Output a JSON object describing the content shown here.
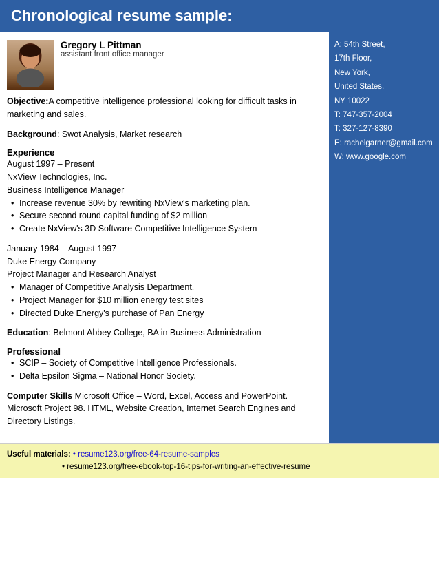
{
  "header": {
    "title": "Chronological resume sample:"
  },
  "profile": {
    "name": "Gregory L Pittman",
    "job_title": "assistant front office manager",
    "photo_alt": "profile photo"
  },
  "sidebar": {
    "address_line1": "A: 54th Street,",
    "address_line2": "17th Floor,",
    "address_line3": "New York,",
    "address_line4": "United States.",
    "address_line5": "NY 10022",
    "phone1_label": "T:",
    "phone1": "747-357-2004",
    "phone2_label": "T:",
    "phone2": "327-127-8390",
    "email_label": "E:",
    "email": "rachelgarner@gmail.com",
    "web_label": "W:",
    "web": "www.google.com"
  },
  "objective": {
    "label": "Objective:",
    "text": "A competitive intelligence professional looking for difficult tasks in marketing and sales."
  },
  "background": {
    "label": "Background",
    "text": ": Swot Analysis, Market research"
  },
  "experience": {
    "label": "Experience",
    "job1_dates": "August 1997 – Present",
    "job1_company": "NxView Technologies, Inc.",
    "job1_title": "Business Intelligence Manager",
    "job1_bullets": [
      "Increase revenue 30% by rewriting NxView's marketing plan.",
      "Secure second round capital funding of $2 million",
      "Create NxView's 3D Software Competitive Intelligence System"
    ],
    "job2_dates": "January 1984 – August 1997",
    "job2_company": "Duke Energy Company",
    "job2_title": "Project Manager and Research Analyst",
    "job2_bullets": [
      "Manager of Competitive Analysis Department.",
      "Project Manager for $10 million energy test sites",
      "Directed Duke Energy's purchase of Pan Energy"
    ]
  },
  "education": {
    "label": "Education",
    "text": ": Belmont Abbey College, BA in Business Administration"
  },
  "professional": {
    "label": "Professional",
    "bullets": [
      "SCIP – Society of Competitive Intelligence Professionals.",
      "Delta Epsilon Sigma – National Honor Society."
    ]
  },
  "computer_skills": {
    "label": "Computer Skills",
    "text": "Microsoft Office – Word, Excel, Access and PowerPoint. Microsoft Project 98. HTML, Website Creation, Internet Search Engines and Directory Listings."
  },
  "footer": {
    "useful_label": "Useful materials:",
    "link1": "• resume123.org/free-64-resume-samples",
    "link2": "• resume123.org/free-ebook-top-16-tips-for-writing-an-effective-resume"
  }
}
